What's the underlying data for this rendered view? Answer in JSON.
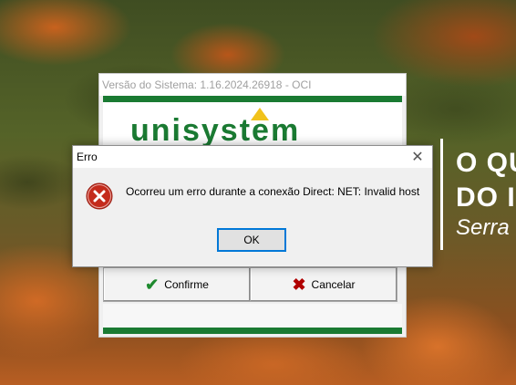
{
  "background": {
    "slogan": [
      "O QU",
      "DO I",
      "Serra"
    ]
  },
  "login_window": {
    "title": "Versão do Sistema: 1.16.2024.26918 - OCI",
    "logo_text": "unisystem",
    "confirm_label": "Confirme",
    "cancel_label": "Cancelar",
    "brand_color": "#1a7a32"
  },
  "error_dialog": {
    "title": "Erro",
    "message": "Ocorreu um erro durante a conexão Direct: NET: Invalid host",
    "ok_label": "OK",
    "icon": "error-icon"
  }
}
